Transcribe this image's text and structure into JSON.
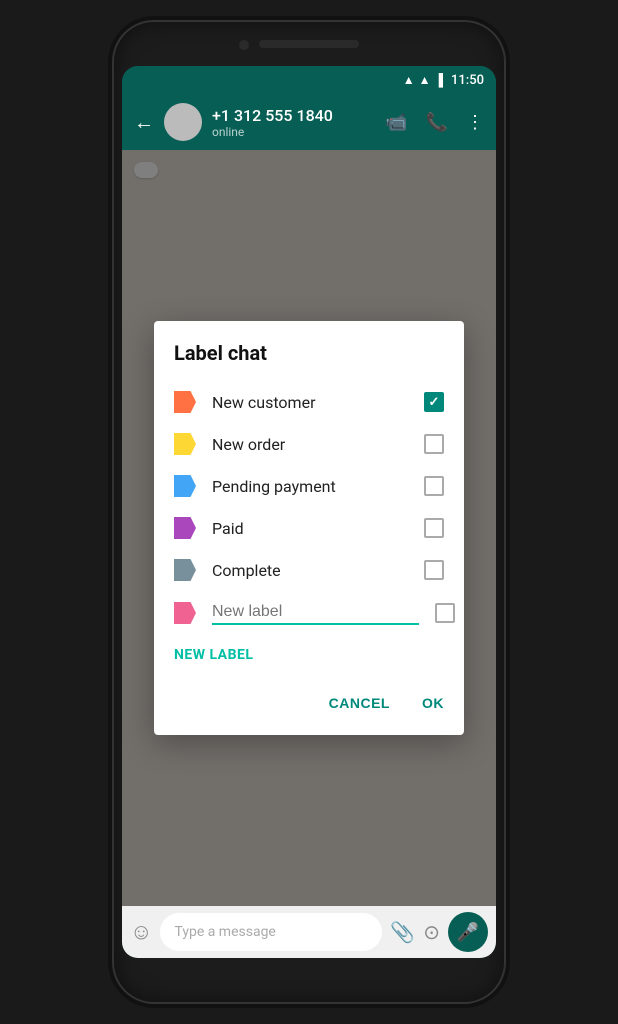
{
  "phone": {
    "status_bar": {
      "time": "11:50"
    },
    "header": {
      "contact_name": "+1 312 555 1840",
      "contact_status": "online",
      "back_label": "←"
    },
    "chat_input": {
      "placeholder": "Type a message"
    }
  },
  "modal": {
    "title": "Label chat",
    "labels": [
      {
        "id": "new-customer",
        "name": "New customer",
        "color": "#ff7043",
        "checked": true
      },
      {
        "id": "new-order",
        "name": "New order",
        "color": "#fdd835",
        "checked": false
      },
      {
        "id": "pending-payment",
        "name": "Pending payment",
        "color": "#42a5f5",
        "checked": false
      },
      {
        "id": "paid",
        "name": "Paid",
        "color": "#ab47bc",
        "checked": false
      },
      {
        "id": "complete",
        "name": "Complete",
        "color": "#78909c",
        "checked": false
      }
    ],
    "new_label_placeholder": "New label",
    "new_label_button": "NEW LABEL",
    "cancel_button": "CANCEL",
    "ok_button": "OK"
  }
}
